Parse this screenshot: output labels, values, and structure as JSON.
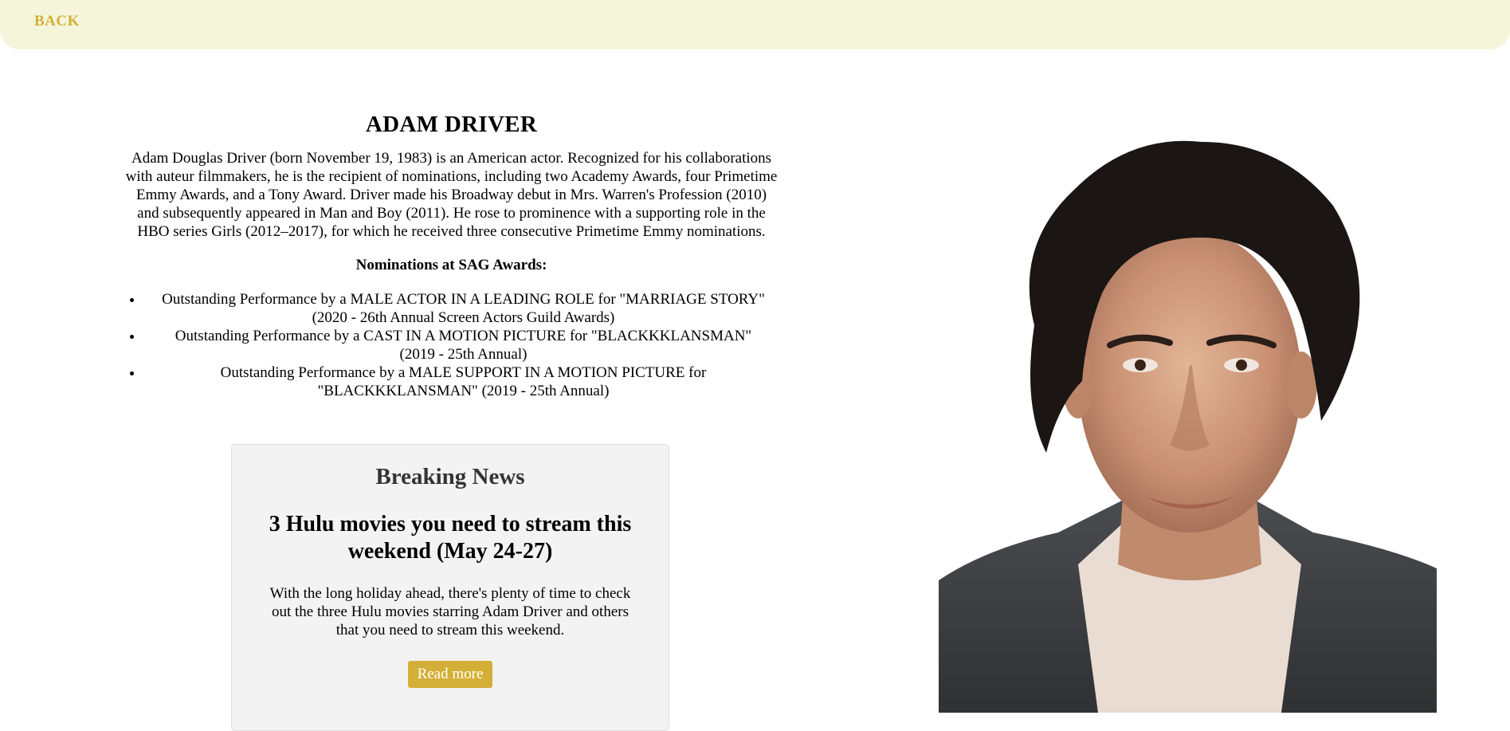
{
  "nav": {
    "back_label": "BACK"
  },
  "actor": {
    "name": "ADAM DRIVER",
    "bio": "Adam Douglas Driver (born November 19, 1983) is an American actor. Recognized for his collaborations with auteur filmmakers, he is the recipient of nominations, including two Academy Awards, four Primetime Emmy Awards, and a Tony Award. Driver made his Broadway debut in Mrs. Warren's Profession (2010) and subsequently appeared in Man and Boy (2011). He rose to prominence with a supporting role in the HBO series Girls (2012–2017), for which he received three consecutive Primetime Emmy nominations."
  },
  "nominations": {
    "title": "Nominations at SAG Awards:",
    "items": [
      "Outstanding Performance by a MALE ACTOR IN A LEADING ROLE for \"MARRIAGE STORY\" (2020 - 26th Annual Screen Actors Guild Awards)",
      "Outstanding Performance by a CAST IN A MOTION PICTURE for \"BLACKKKLANSMAN\" (2019 - 25th Annual)",
      "Outstanding Performance by a MALE SUPPORT IN A MOTION PICTURE for \"BLACKKKLANSMAN\" (2019 - 25th Annual)"
    ]
  },
  "news": {
    "heading": "Breaking News",
    "title": "3 Hulu movies you need to stream this weekend (May 24-27)",
    "text": "With the long holiday ahead, there's plenty of time to check out the three Hulu movies starring Adam Driver and others that you need to stream this weekend.",
    "button_label": "Read more"
  },
  "colors": {
    "topbar_bg": "#f5f5dc",
    "accent": "#d4af37",
    "card_bg": "#f3f3f3"
  }
}
